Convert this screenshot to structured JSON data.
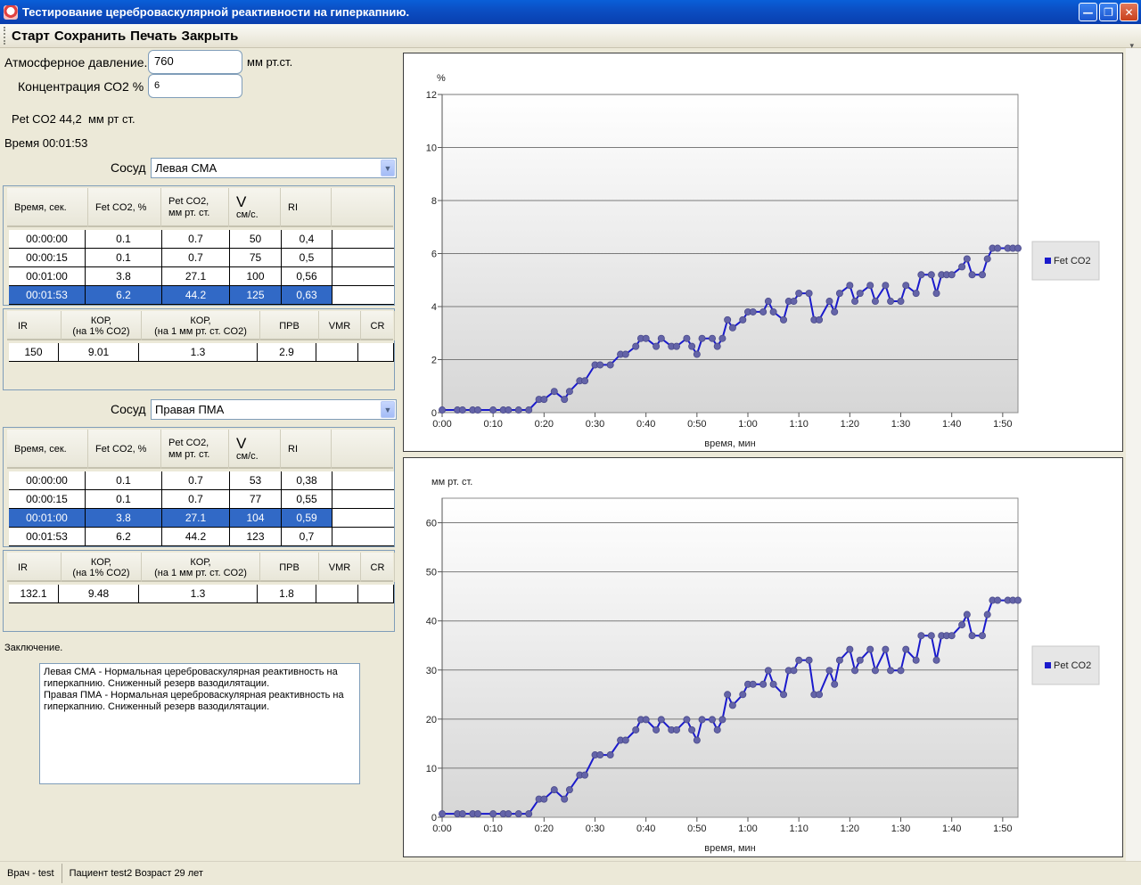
{
  "window": {
    "title": "Тестирование цереброваскулярной реактивности на гиперкапнию."
  },
  "toolbar": {
    "items": [
      "Старт",
      "Сохранить",
      "Печать",
      "Закрыть"
    ]
  },
  "form": {
    "pressure_label": "Атмосферное давление.",
    "pressure_value": "760",
    "pressure_unit": "мм рт.ст.",
    "co2_label": "Концентрация СО2 %",
    "co2_value": "6",
    "pet_co2_text": "Pet CO2 44,2  мм рт ст.",
    "time_text": "Время 00:01:53"
  },
  "vessel1": {
    "label": "Сосуд",
    "selected": "Левая СМА",
    "columns": [
      "Время, сек.",
      "Fet CO2, %",
      "Pet CO2,\nмм рт. ст.",
      "V",
      "см/с.",
      "RI"
    ],
    "rows": [
      [
        "00:00:00",
        "0.1",
        "0.7",
        "50",
        "0,4"
      ],
      [
        "00:00:15",
        "0.1",
        "0.7",
        "75",
        "0,5"
      ],
      [
        "00:01:00",
        "3.8",
        "27.1",
        "100",
        "0,56"
      ],
      [
        "00:01:53",
        "6.2",
        "44.2",
        "125",
        "0,63"
      ]
    ],
    "selected_row": 3,
    "summary_columns": [
      "IR",
      "КОР,\n(на 1% CO2)",
      "КОР,\n(на 1 мм рт. ст. CO2)",
      "ПРВ",
      "VMR",
      "CR"
    ],
    "summary_values": [
      "150",
      "9.01",
      "1.3",
      "2.9",
      "",
      ""
    ]
  },
  "vessel2": {
    "label": "Сосуд",
    "selected": "Правая ПМА",
    "columns": [
      "Время, сек.",
      "Fet CO2, %",
      "Pet CO2,\nмм рт. ст.",
      "V",
      "см/с.",
      "RI"
    ],
    "rows": [
      [
        "00:00:00",
        "0.1",
        "0.7",
        "53",
        "0,38"
      ],
      [
        "00:00:15",
        "0.1",
        "0.7",
        "77",
        "0,55"
      ],
      [
        "00:01:00",
        "3.8",
        "27.1",
        "104",
        "0,59"
      ],
      [
        "00:01:53",
        "6.2",
        "44.2",
        "123",
        "0,7"
      ]
    ],
    "selected_row": 2,
    "summary_columns": [
      "IR",
      "КОР,\n(на 1% CO2)",
      "КОР,\n(на 1 мм рт. ст. CO2)",
      "ПРВ",
      "VMR",
      "CR"
    ],
    "summary_values": [
      "132.1",
      "9.48",
      "1.3",
      "1.8",
      "",
      ""
    ]
  },
  "conclusion": {
    "label": "Заключение.",
    "text": "Левая СМА - Нормальная цереброваскулярная реактивность на гиперкапнию. Сниженный резерв вазодилятации.\nПравая ПМА - Нормальная цереброваскулярная реактивность на гиперкапнию. Сниженный резерв вазодилятации."
  },
  "status": {
    "doctor": "Врач - test",
    "patient": "Пациент test2 Возраст 29 лет"
  },
  "colors": {
    "line": "#1a1acc",
    "marker": "#6464a8",
    "selection": "#3169c6"
  },
  "chart_data": [
    {
      "type": "line",
      "ylabel": "%",
      "xlabel": "время, мин",
      "xlim": [
        0,
        113
      ],
      "ylim": [
        0,
        12
      ],
      "yticks": [
        0,
        2,
        4,
        6,
        8,
        10,
        12
      ],
      "xticks": [
        "0:00",
        "0:10",
        "0:20",
        "0:30",
        "0:40",
        "0:50",
        "1:00",
        "1:10",
        "1:20",
        "1:30",
        "1:40",
        "1:50"
      ],
      "legend": "right",
      "series": [
        {
          "name": "Fet CO2",
          "x": [
            0,
            3,
            4,
            6,
            7,
            10,
            12,
            13,
            15,
            17,
            19,
            20,
            22,
            24,
            25,
            27,
            28,
            30,
            31,
            33,
            35,
            36,
            38,
            39,
            40,
            42,
            43,
            45,
            46,
            48,
            49,
            50,
            51,
            53,
            54,
            55,
            56,
            57,
            59,
            60,
            61,
            63,
            64,
            65,
            67,
            68,
            69,
            70,
            72,
            73,
            74,
            76,
            77,
            78,
            80,
            81,
            82,
            84,
            85,
            87,
            88,
            90,
            91,
            93,
            94,
            96,
            97,
            98,
            99,
            100,
            102,
            103,
            104,
            106,
            107,
            108,
            109,
            111,
            112,
            113
          ],
          "values": [
            0.1,
            0.1,
            0.1,
            0.1,
            0.1,
            0.1,
            0.1,
            0.1,
            0.1,
            0.1,
            0.5,
            0.5,
            0.8,
            0.5,
            0.8,
            1.2,
            1.2,
            1.8,
            1.8,
            1.8,
            2.2,
            2.2,
            2.5,
            2.8,
            2.8,
            2.5,
            2.8,
            2.5,
            2.5,
            2.8,
            2.5,
            2.2,
            2.8,
            2.8,
            2.5,
            2.8,
            3.5,
            3.2,
            3.5,
            3.8,
            3.8,
            3.8,
            4.2,
            3.8,
            3.5,
            4.2,
            4.2,
            4.5,
            4.5,
            3.5,
            3.5,
            4.2,
            3.8,
            4.5,
            4.8,
            4.2,
            4.5,
            4.8,
            4.2,
            4.8,
            4.2,
            4.2,
            4.8,
            4.5,
            5.2,
            5.2,
            4.5,
            5.2,
            5.2,
            5.2,
            5.5,
            5.8,
            5.2,
            5.2,
            5.8,
            6.2,
            6.2,
            6.2,
            6.2,
            6.2
          ]
        }
      ]
    },
    {
      "type": "line",
      "ylabel": "мм рт. ст.",
      "xlabel": "время, мин",
      "xlim": [
        0,
        113
      ],
      "ylim": [
        0,
        65
      ],
      "yticks": [
        0,
        10,
        20,
        30,
        40,
        50,
        60
      ],
      "xticks": [
        "0:00",
        "0:10",
        "0:20",
        "0:30",
        "0:40",
        "0:50",
        "1:00",
        "1:10",
        "1:20",
        "1:30",
        "1:40",
        "1:50"
      ],
      "legend": "right",
      "series": [
        {
          "name": "Pet CO2",
          "x": [
            0,
            3,
            4,
            6,
            7,
            10,
            12,
            13,
            15,
            17,
            19,
            20,
            22,
            24,
            25,
            27,
            28,
            30,
            31,
            33,
            35,
            36,
            38,
            39,
            40,
            42,
            43,
            45,
            46,
            48,
            49,
            50,
            51,
            53,
            54,
            55,
            56,
            57,
            59,
            60,
            61,
            63,
            64,
            65,
            67,
            68,
            69,
            70,
            72,
            73,
            74,
            76,
            77,
            78,
            80,
            81,
            82,
            84,
            85,
            87,
            88,
            90,
            91,
            93,
            94,
            96,
            97,
            98,
            99,
            100,
            102,
            103,
            104,
            106,
            107,
            108,
            109,
            111,
            112,
            113
          ],
          "values": [
            0.7,
            0.7,
            0.7,
            0.7,
            0.7,
            0.7,
            0.7,
            0.7,
            0.7,
            0.7,
            3.7,
            3.7,
            5.6,
            3.7,
            5.6,
            8.6,
            8.6,
            12.7,
            12.7,
            12.7,
            15.7,
            15.7,
            17.8,
            19.9,
            19.9,
            17.8,
            19.9,
            17.8,
            17.8,
            19.9,
            17.8,
            15.7,
            19.9,
            19.9,
            17.8,
            19.9,
            25.0,
            22.8,
            25.0,
            27.1,
            27.1,
            27.1,
            29.9,
            27.1,
            25.0,
            29.9,
            29.9,
            32.0,
            32.0,
            25.0,
            25.0,
            29.9,
            27.1,
            32.0,
            34.2,
            29.9,
            32.0,
            34.2,
            29.9,
            34.2,
            29.9,
            29.9,
            34.2,
            32.0,
            37.0,
            37.0,
            32.0,
            37.0,
            37.0,
            37.0,
            39.2,
            41.3,
            37.0,
            37.0,
            41.3,
            44.2,
            44.2,
            44.2,
            44.2,
            44.2
          ]
        }
      ]
    }
  ]
}
